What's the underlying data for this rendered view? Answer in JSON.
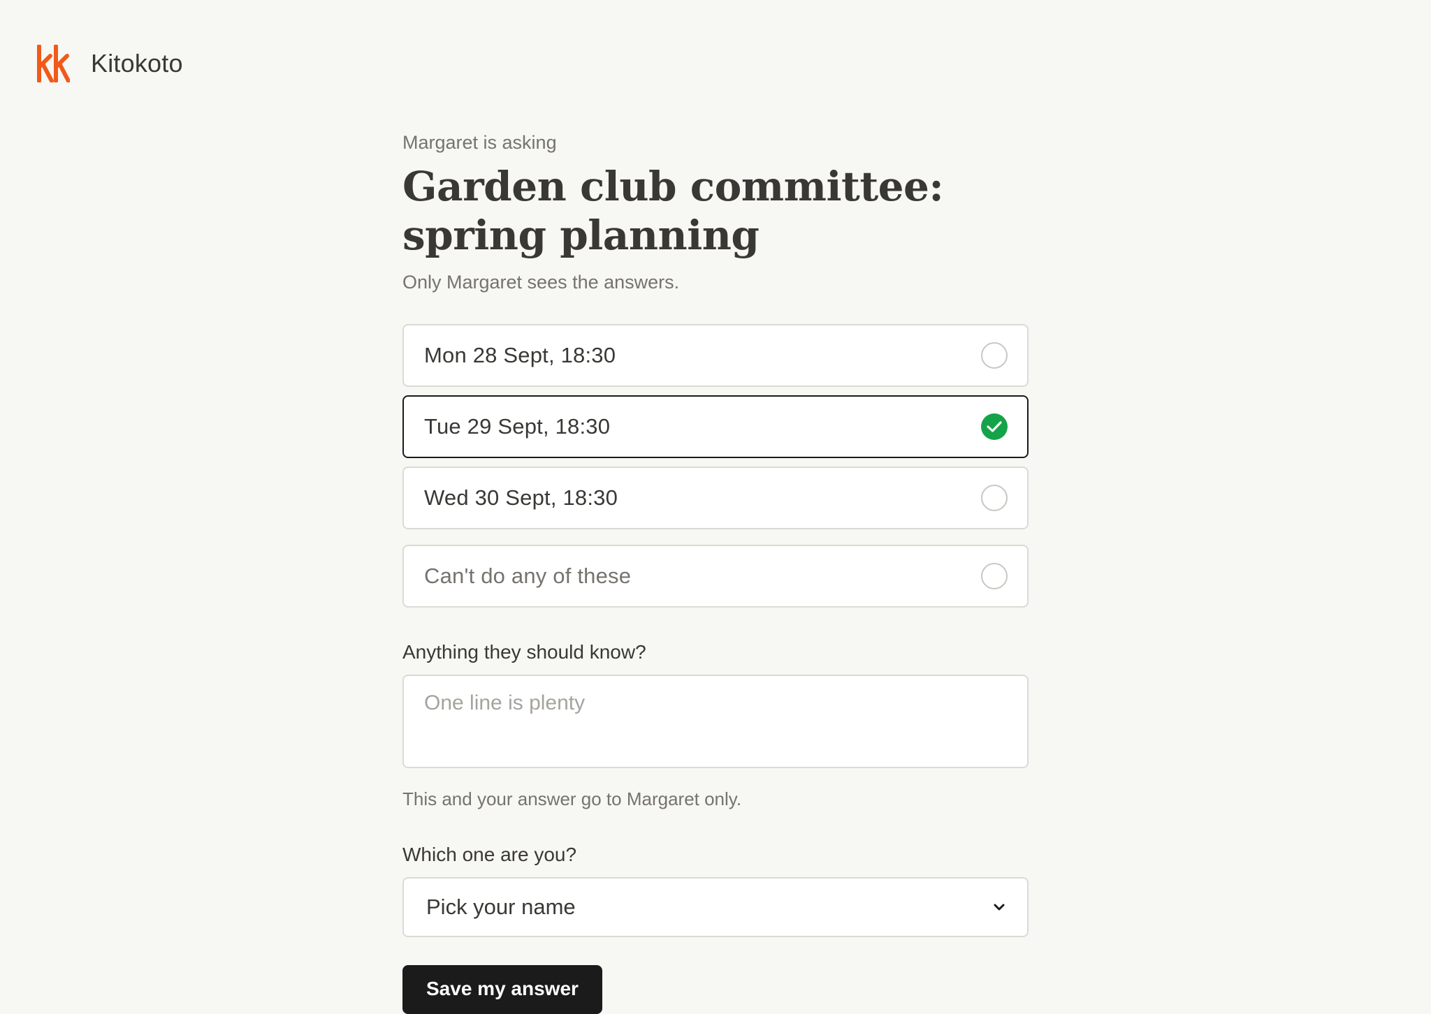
{
  "brand": {
    "name": "Kitokoto",
    "logo_icon": "kk-logo-icon",
    "logo_color": "#f05a1a"
  },
  "poll": {
    "asker_line": "Margaret is asking",
    "title_line1": "Garden club committee:",
    "title_line2": "spring planning",
    "privacy_note": "Only Margaret sees the answers."
  },
  "options": [
    {
      "label": "Mon 28 Sept, 18:30",
      "selected": false
    },
    {
      "label": "Tue 29 Sept, 18:30",
      "selected": true
    },
    {
      "label": "Wed 30 Sept, 18:30",
      "selected": false
    },
    {
      "label": "Can't do any of these",
      "selected": false
    }
  ],
  "notes": {
    "label": "Anything they should know?",
    "placeholder": "One line is plenty",
    "value": "",
    "helper": "This and your answer go to Margaret only."
  },
  "identity": {
    "label": "Which one are you?",
    "selected_value": "Pick your name"
  },
  "actions": {
    "save_label": "Save my answer"
  },
  "colors": {
    "background": "#f7f7f3",
    "selected_check": "#15a34a",
    "primary_button": "#1b1b1b"
  }
}
